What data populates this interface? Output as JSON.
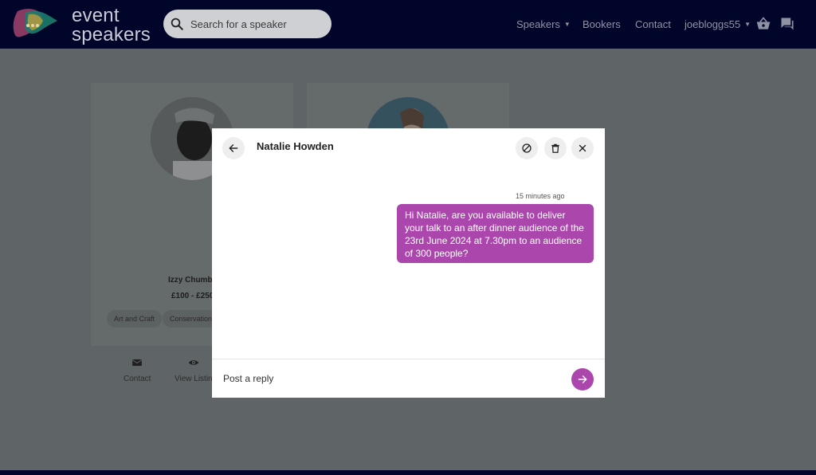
{
  "header": {
    "logo_line1": "event",
    "logo_line2": "speakers",
    "search_placeholder": "Search for a speaker",
    "nav": {
      "speakers": "Speakers",
      "bookers": "Bookers",
      "contact": "Contact",
      "user": "joebloggs55"
    }
  },
  "listing": {
    "cards": [
      {
        "name": "Izzy Chumb",
        "price": "£100 - £250",
        "tags": [
          "Art and Craft",
          "Conservation"
        ],
        "actions": [
          "Contact",
          "View Listin"
        ]
      }
    ]
  },
  "modal": {
    "title": "Natalie Howden",
    "message": {
      "timestamp": "15 minutes ago",
      "text": "Hi Natalie, are you available to deliver your talk to an after dinner audience of the 23rd June 2024 at 7.30pm to an audience of 300 people?"
    },
    "reply_placeholder": "Post a reply"
  },
  "colors": {
    "header_bg": "#02052a",
    "overlay_bg": "#5f6566",
    "accent": "#ab47ac"
  },
  "icons": {
    "search": "search-icon",
    "basket": "basket-icon",
    "messages": "chat-icon",
    "back": "arrow-left-icon",
    "block": "block-icon",
    "delete": "trash-icon",
    "close": "close-icon",
    "send": "arrow-right-icon"
  }
}
